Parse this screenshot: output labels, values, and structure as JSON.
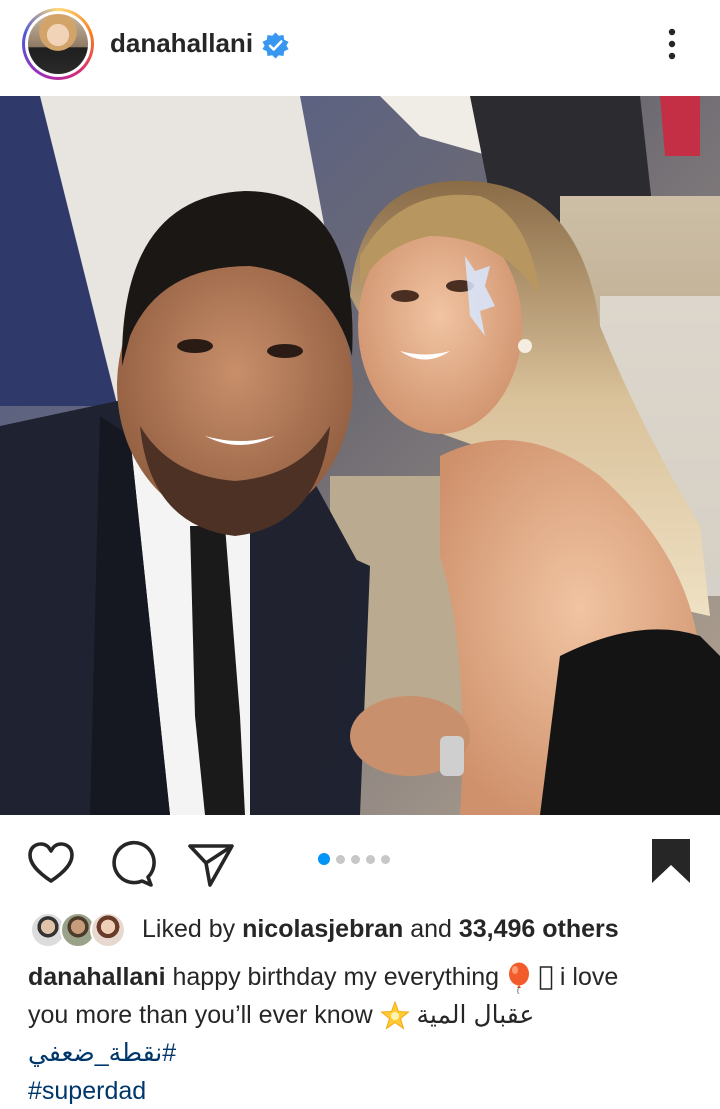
{
  "post": {
    "username": "danahallani",
    "verified": true,
    "carousel": {
      "count": 5,
      "active_index": 0
    },
    "likes": {
      "prefix": "Liked by",
      "user": "nicolasjebran",
      "connector": "and",
      "count": "33,496 others"
    },
    "caption": {
      "username": "danahallani",
      "line1_text": "happy birthday my everything",
      "line1_tail": "i love",
      "line2_text": "you more than you’ll ever know",
      "line2_arabic": "عقبال المية",
      "hashtag1": "#نقطة_ضعفي",
      "hashtag2": "#superdad"
    }
  },
  "icons": {
    "like": "heart-icon",
    "comment": "comment-icon",
    "share": "send-icon",
    "save": "bookmark-icon",
    "more": "more-vertical-icon",
    "verified": "verified-badge-icon"
  },
  "colors": {
    "link": "#00376b",
    "verified": "#3897f0",
    "dot_active": "#0095f6",
    "dot_inactive": "#c7c7c7"
  }
}
